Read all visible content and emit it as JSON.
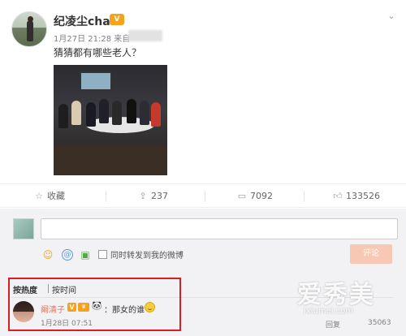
{
  "post": {
    "username": "纪凌尘chan",
    "vip_label": "V",
    "meta": "1月27日 21:28 来自",
    "text": "猜猜都有哪些老人？",
    "menu_icon": "chevron-down-icon"
  },
  "stats": {
    "favorite_label": "收藏",
    "repost_count": "237",
    "comment_count": "7092",
    "like_count": "133526"
  },
  "comment_box": {
    "input_value": "",
    "forward_label": "同时转发到我的微博",
    "submit_label": "评论"
  },
  "sort": {
    "hot": "按热度",
    "time": "按时间"
  },
  "comment": {
    "user": "阚清子",
    "vbadge": "V",
    "text": "：那女的谁",
    "time": "1月28日 07:51",
    "reply": "回复",
    "likes": "35063"
  },
  "watermark": {
    "title": "爱秀美",
    "url": "ixiumei.com"
  },
  "colors": {
    "accent_orange": "#eb7350",
    "highlight_red": "#d31f25",
    "submit_disabled": "#f7c9b4"
  }
}
